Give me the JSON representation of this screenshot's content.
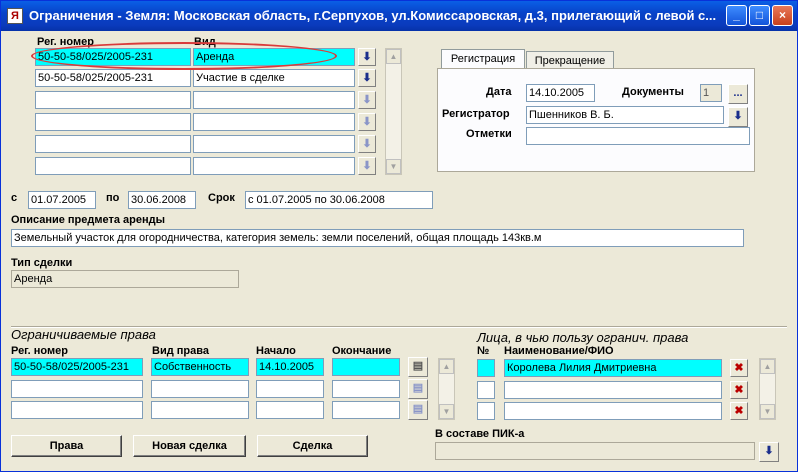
{
  "window": {
    "title": "Ограничения - Земля: Московская область, г.Серпухов, ул.Комиссаровская, д.3, прилегающий с левой с...",
    "app_icon": "app-icon",
    "minimize": "_",
    "maximize": "□",
    "close": "×"
  },
  "top_grid": {
    "col_reg": "Рег. номер",
    "col_type": "Вид",
    "rows": [
      {
        "reg": "50-50-58/025/2005-231",
        "type": "Аренда"
      },
      {
        "reg": "50-50-58/025/2005-231",
        "type": "Участие в сделке"
      },
      {
        "reg": "",
        "type": ""
      },
      {
        "reg": "",
        "type": ""
      },
      {
        "reg": "",
        "type": ""
      },
      {
        "reg": "",
        "type": ""
      }
    ]
  },
  "tabs": {
    "registration": "Регистрация",
    "termination": "Прекращение"
  },
  "registration": {
    "date_label": "Дата",
    "date_value": "14.10.2005",
    "docs_label": "Документы",
    "docs_value": "1",
    "docs_button": "...",
    "registrar_label": "Регистратор",
    "registrar_value": "Пшенников В. Б.",
    "notes_label": "Отметки",
    "notes_value": ""
  },
  "period": {
    "from_label": "с",
    "from_value": "01.07.2005",
    "to_label": "по",
    "to_value": "30.06.2008",
    "term_label": "Срок",
    "term_value": "с 01.07.2005 по 30.06.2008"
  },
  "description": {
    "label": "Описание предмета аренды",
    "value": "Земельный участок для огородничества, категория земель: земли поселений, общая площадь 143кв.м"
  },
  "deal_type": {
    "label": "Тип сделки",
    "value": "Аренда"
  },
  "restricted_rights": {
    "section_title": "Ограничиваемые права",
    "col_reg": "Рег. номер",
    "col_type": "Вид права",
    "col_start": "Начало",
    "col_end": "Окончание",
    "rows": [
      {
        "reg": "50-50-58/025/2005-231",
        "type": "Собственность",
        "start": "14.10.2005",
        "end": ""
      },
      {
        "reg": "",
        "type": "",
        "start": "",
        "end": ""
      },
      {
        "reg": "",
        "type": "",
        "start": "",
        "end": ""
      }
    ]
  },
  "beneficiaries": {
    "section_title": "Лица, в чью пользу огранич. права",
    "col_num": "№",
    "col_name": "Наименование/ФИО",
    "rows": [
      {
        "num": "",
        "name": "Королева Лилия Дмитриевна"
      },
      {
        "num": "",
        "name": ""
      },
      {
        "num": "",
        "name": ""
      }
    ]
  },
  "buttons": {
    "rights": "Права",
    "new_deal": "Новая сделка",
    "deal": "Сделка"
  },
  "pik": {
    "label": "В составе ПИК-а",
    "value": ""
  },
  "glyphs": {
    "down": "⬇",
    "cross": "✖",
    "scroll_up": "▲",
    "scroll_down": "▼",
    "doc": "▤"
  }
}
